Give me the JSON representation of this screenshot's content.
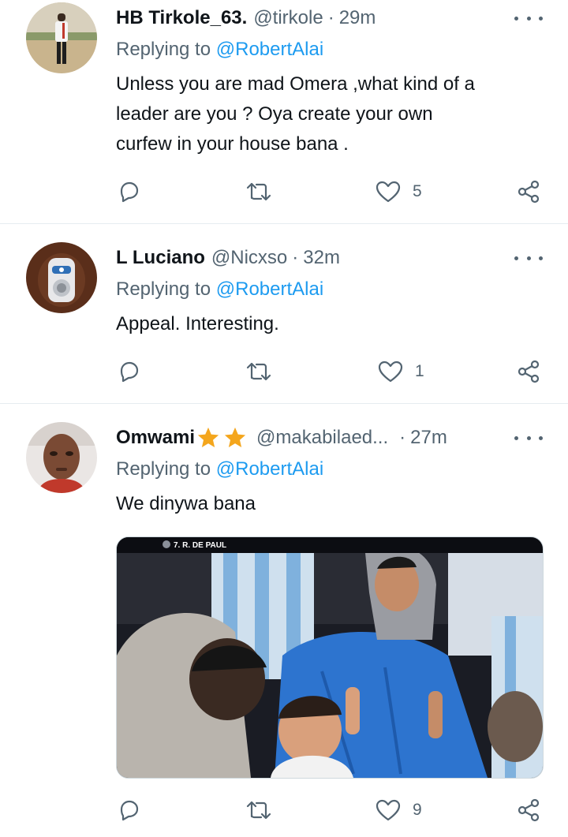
{
  "tweets": [
    {
      "name": "HB Tirkole_63.",
      "handle": "@tirkole",
      "time": "29m",
      "replying_prefix": "Replying to",
      "replying_to": "@RobertAlai",
      "text_lines": [
        "Unless you are  mad Omera ,what kind of a",
        "leader are you ? Oya create your own",
        "curfew in your house bana ."
      ],
      "likes": "5"
    },
    {
      "name": "L Luciano",
      "handle": "@Nicxso",
      "time": "32m",
      "replying_prefix": "Replying to",
      "replying_to": "@RobertAlai",
      "text_lines": [
        "Appeal. Interesting."
      ],
      "likes": "1"
    },
    {
      "name": "Omwami",
      "handle": "@makabilaed...",
      "time": "27m",
      "replying_prefix": "Replying to",
      "replying_to": "@RobertAlai",
      "text_lines": [
        "We dinywa bana"
      ],
      "media_caption": "7. R. DE PAUL",
      "likes": "9"
    }
  ],
  "separator": "·",
  "icons": [
    "more-icon",
    "reply-icon",
    "retweet-icon",
    "like-icon",
    "share-icon",
    "star-icon"
  ],
  "colors": {
    "mention": "#1d9bf0",
    "secondary": "#536471",
    "star": "#f4a61d",
    "divider": "#e6ecf0"
  }
}
